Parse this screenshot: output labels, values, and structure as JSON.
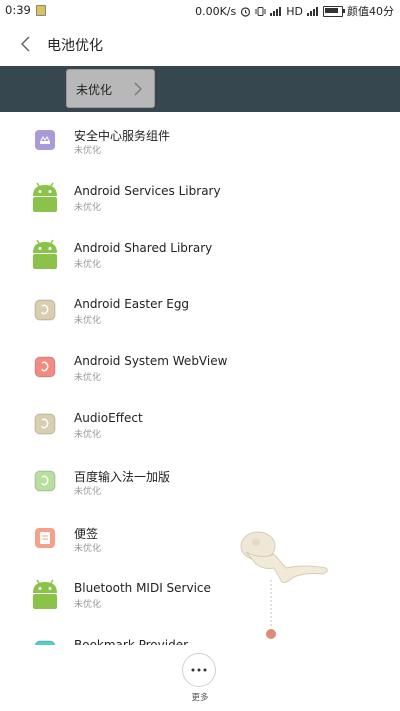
{
  "status_bar": {
    "time": "0:39",
    "network_speed": "0.00K/s",
    "hd": "HD",
    "carrier": "颜值40分"
  },
  "header": {
    "title": "电池优化",
    "back_icon": "back-arrow-icon"
  },
  "filter": {
    "selected": "未优化",
    "icon": "chevron-right-icon"
  },
  "apps": [
    {
      "name": "安全中心服务组件",
      "status": "未优化",
      "icon": "security-center-icon",
      "color": "#a99ad8"
    },
    {
      "name": "Android Services Library",
      "status": "未优化",
      "icon": "android-icon",
      "color": "#8bc34a"
    },
    {
      "name": "Android Shared Library",
      "status": "未优化",
      "icon": "android-icon",
      "color": "#8bc34a"
    },
    {
      "name": "Android Easter Egg",
      "status": "未优化",
      "icon": "generic-app-icon",
      "color": "#d9ceb0"
    },
    {
      "name": "Android System WebView",
      "status": "未优化",
      "icon": "generic-app-icon",
      "color": "#f28b82"
    },
    {
      "name": "AudioEffect",
      "status": "未优化",
      "icon": "generic-app-icon",
      "color": "#d9ceb0"
    },
    {
      "name": "百度输入法一加版",
      "status": "未优化",
      "icon": "generic-app-icon",
      "color": "#b9df9c"
    },
    {
      "name": "便签",
      "status": "未优化",
      "icon": "notes-icon",
      "color": "#f4a08a"
    },
    {
      "name": "Bluetooth MIDI Service",
      "status": "未优化",
      "icon": "android-icon",
      "color": "#8bc34a"
    },
    {
      "name": "Bookmark Provider",
      "status": "",
      "icon": "generic-app-icon",
      "color": "#4dd0c8"
    }
  ],
  "bottom": {
    "more_label": "更多",
    "more_icon": "more-dots-icon"
  }
}
